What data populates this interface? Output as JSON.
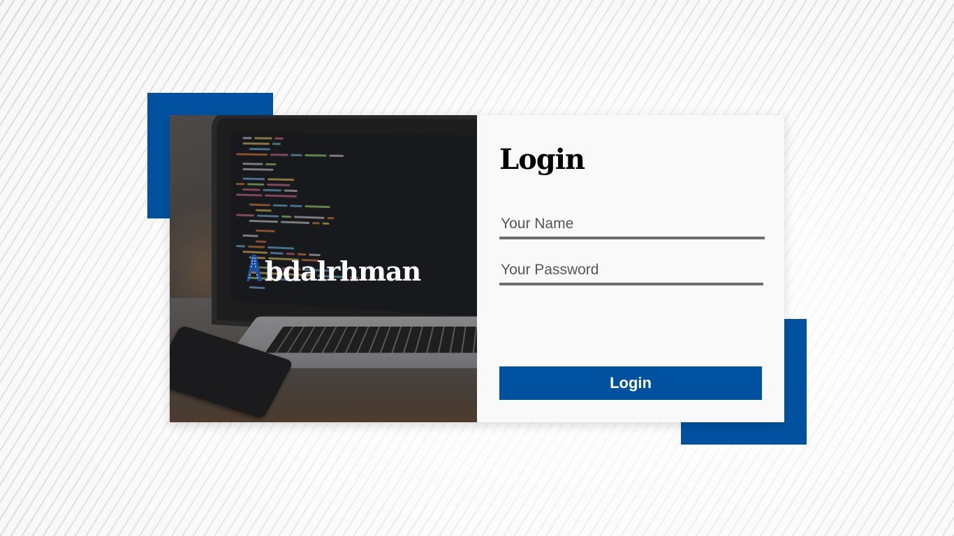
{
  "brand": {
    "name": "bdalrhman",
    "logo_icon": "building-letter-a-icon",
    "accent_color": "#0052a1"
  },
  "login_form": {
    "title": "Login",
    "name_field": {
      "placeholder": "Your Name",
      "value": ""
    },
    "password_field": {
      "placeholder": "Your Password",
      "value": ""
    },
    "submit_label": "Login"
  }
}
